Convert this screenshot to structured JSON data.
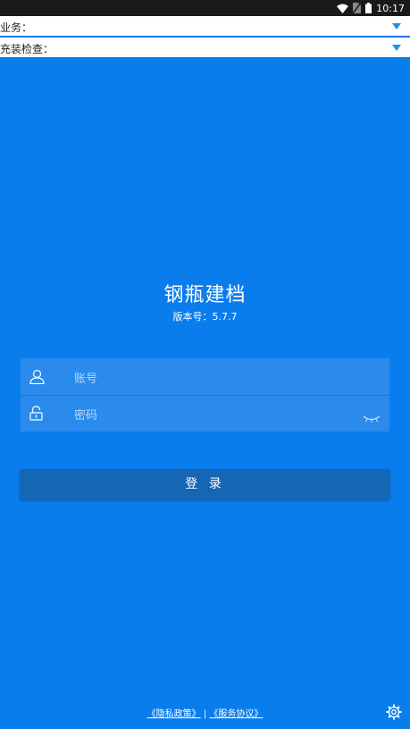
{
  "status_bar": {
    "time": "10:17"
  },
  "selectors": {
    "business_label": "业务：",
    "check_label": "充装检查："
  },
  "app": {
    "title": "钢瓶建档",
    "version": "版本号：5.7.7"
  },
  "form": {
    "account_placeholder": "账号",
    "password_placeholder": "密码"
  },
  "login_label": "登 录",
  "footer": {
    "privacy": "《隐私政策》",
    "separator": " | ",
    "service": "《服务协议》"
  },
  "colors": {
    "background": "#0a7ded",
    "input_bg": "#2a8bed",
    "button_bg": "#1566b5",
    "dropdown_arrow": "#1e90e6"
  },
  "icons": [
    "wifi-icon",
    "no-sim-icon",
    "battery-icon",
    "user-icon",
    "lock-icon",
    "eye-closed-icon",
    "settings-icon"
  ]
}
